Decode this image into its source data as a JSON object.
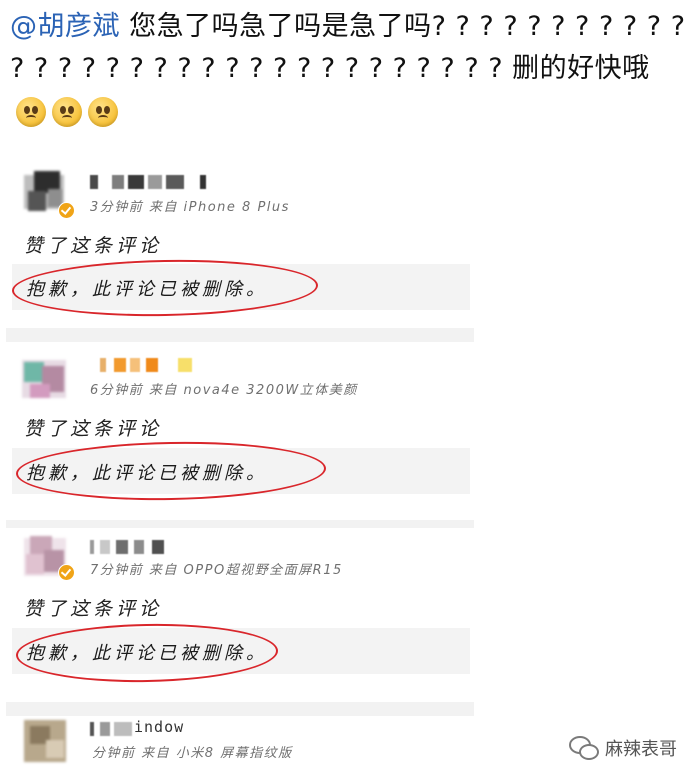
{
  "post": {
    "mention": "@胡彦斌",
    "text": " 您急了吗急了吗是急了吗? ? ? ? ? ? ? ? ? ? ? ? ? ? ? ? ? ? ? ? ? ? ? ? ? ? ? ? ? ? ? ? 删的好快哦",
    "emojis": [
      "sad-face-emoji",
      "sad-face-emoji",
      "sad-face-emoji"
    ]
  },
  "comments": [
    {
      "name_text": "",
      "verified": true,
      "meta": "3分钟前  来自 iPhone 8 Plus",
      "body": "赞了这条评论",
      "quote": "抱歉，此评论已被删除。"
    },
    {
      "name_text": "",
      "verified": false,
      "meta": "6分钟前  来自 nova4e 3200W立体美颜",
      "body": "赞了这条评论",
      "quote": "抱歉，此评论已被删除。"
    },
    {
      "name_text": "",
      "verified": true,
      "meta": "7分钟前  来自 OPPO超视野全面屏R15",
      "body": "赞了这条评论",
      "quote": "抱歉，此评论已被删除。"
    },
    {
      "name_text": "indow",
      "verified": false,
      "meta": "分钟前  来自 小米8 屏幕指纹版",
      "body": "",
      "quote": ""
    }
  ],
  "watermark": {
    "icon": "wechat-icon",
    "text": "麻辣表哥"
  },
  "colors": {
    "mention": "#2b63b5",
    "highlight_ellipse": "#d9262b",
    "quote_bg": "#f3f3f3",
    "badge": "#f0a417"
  }
}
